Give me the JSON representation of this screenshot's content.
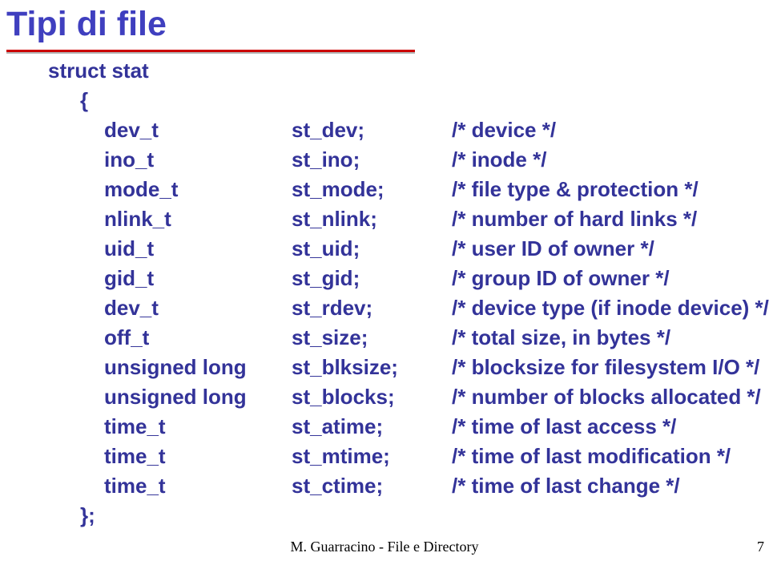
{
  "title": "Tipi di file",
  "struct_open": "struct stat",
  "brace_open": "{",
  "brace_close": "};",
  "rows": [
    {
      "type": "dev_t",
      "field": "st_dev;",
      "comment": "/* device */"
    },
    {
      "type": "ino_t",
      "field": "st_ino;",
      "comment": "/* inode */"
    },
    {
      "type": "mode_t",
      "field": "st_mode;",
      "comment": "/* file type & protection */"
    },
    {
      "type": "nlink_t",
      "field": "st_nlink;",
      "comment": "/* number of hard links */"
    },
    {
      "type": "uid_t",
      "field": "st_uid;",
      "comment": "/* user ID of owner */"
    },
    {
      "type": "gid_t",
      "field": "st_gid;",
      "comment": "/* group ID of owner */"
    },
    {
      "type": "dev_t",
      "field": "st_rdev;",
      "comment": "/* device type (if inode device) */"
    },
    {
      "type": "off_t",
      "field": "st_size;",
      "comment": "/* total size, in bytes */"
    },
    {
      "type": "unsigned long",
      "field": "st_blksize;",
      "comment": "/* blocksize for filesystem I/O */"
    },
    {
      "type": "unsigned long",
      "field": "st_blocks;",
      "comment": "/* number of blocks allocated */"
    },
    {
      "type": "time_t",
      "field": "st_atime;",
      "comment": "/* time of last access */"
    },
    {
      "type": "time_t",
      "field": "st_mtime;",
      "comment": "/* time of last modification */"
    },
    {
      "type": "time_t",
      "field": "st_ctime;",
      "comment": "/* time of last change */"
    }
  ],
  "footer": "M. Guarracino - File e Directory",
  "page_number": "7"
}
